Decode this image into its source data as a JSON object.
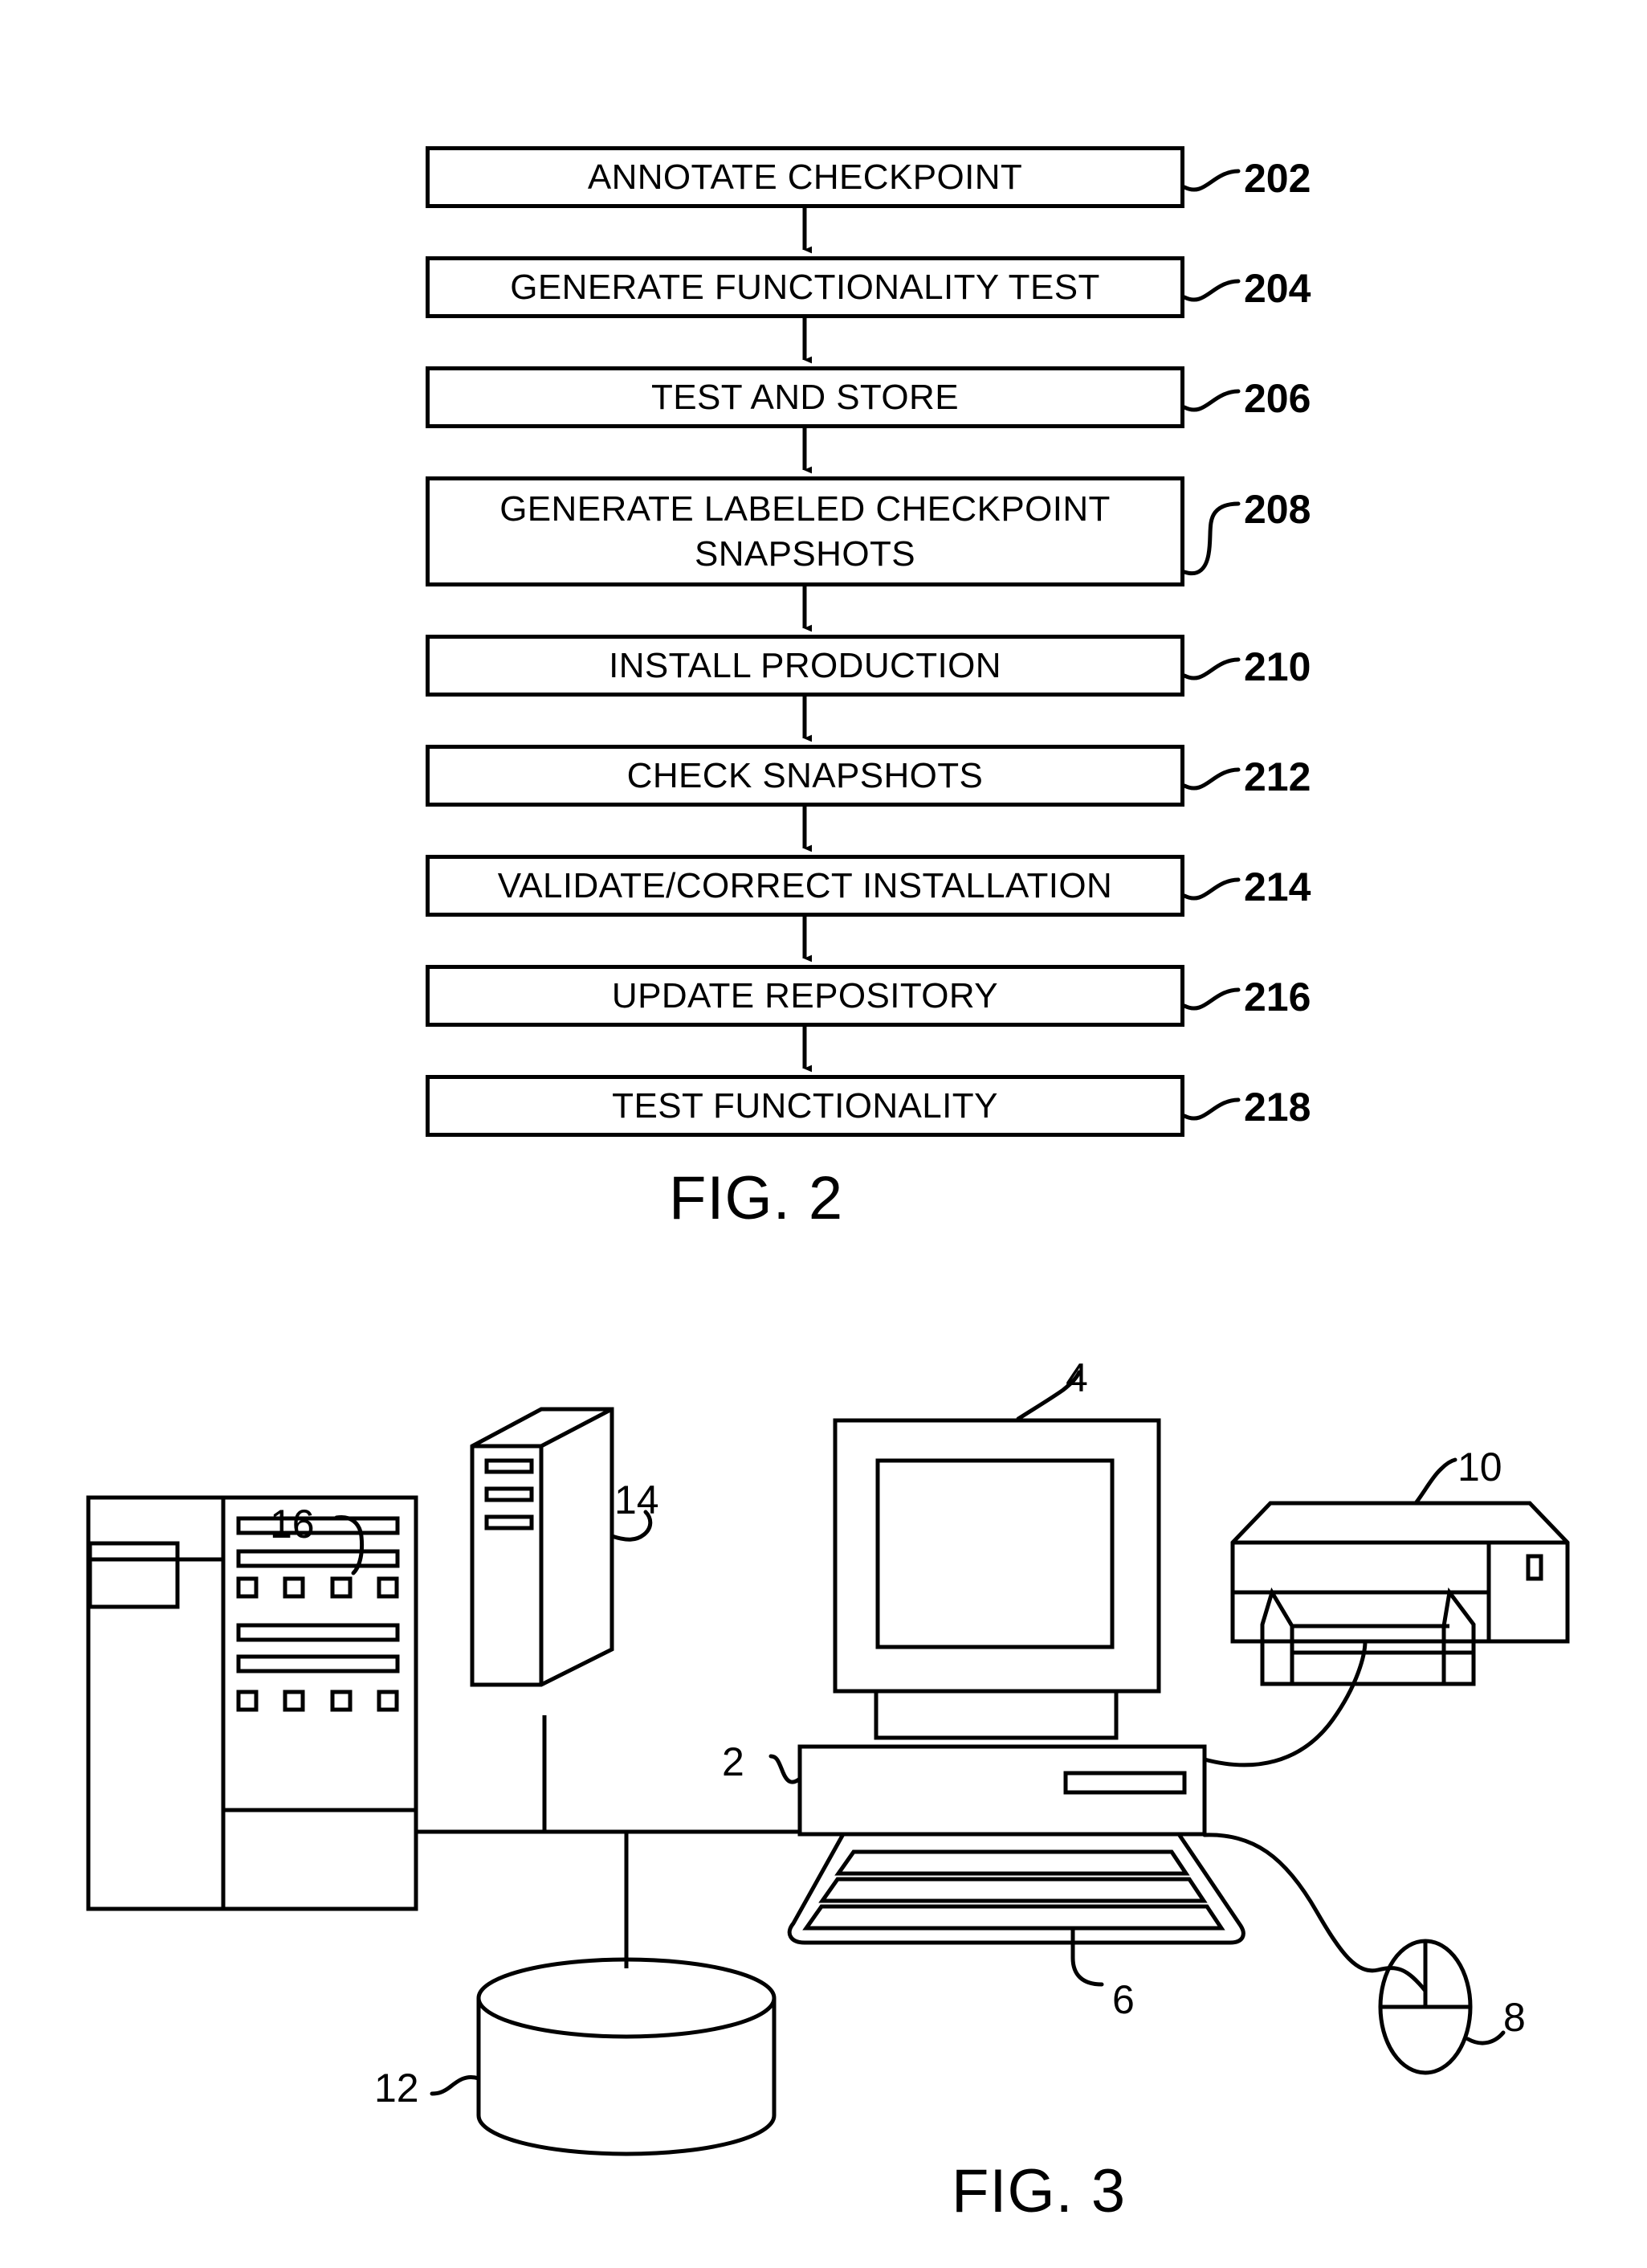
{
  "sheet": {
    "figures": [
      {
        "caption": "FIG. 2",
        "type": "flowchart",
        "steps": [
          {
            "label": "ANNOTATE CHECKPOINT",
            "ref": "202",
            "tall": false
          },
          {
            "label": "GENERATE FUNCTIONALITY TEST",
            "ref": "204",
            "tall": false
          },
          {
            "label": "TEST AND STORE",
            "ref": "206",
            "tall": false
          },
          {
            "label": "GENERATE LABELED CHECKPOINT SNAPSHOTS",
            "ref": "208",
            "tall": true
          },
          {
            "label": "INSTALL PRODUCTION",
            "ref": "210",
            "tall": false
          },
          {
            "label": "CHECK SNAPSHOTS",
            "ref": "212",
            "tall": false
          },
          {
            "label": "VALIDATE/CORRECT INSTALLATION",
            "ref": "214",
            "tall": false
          },
          {
            "label": "UPDATE REPOSITORY",
            "ref": "216",
            "tall": false
          },
          {
            "label": "TEST FUNCTIONALITY",
            "ref": "218",
            "tall": false
          }
        ]
      },
      {
        "caption": "FIG. 3",
        "type": "system-diagram",
        "components": [
          {
            "name": "mainframe",
            "ref": "16"
          },
          {
            "name": "tower-server",
            "ref": "14"
          },
          {
            "name": "monitor",
            "ref": "4"
          },
          {
            "name": "printer",
            "ref": "10"
          },
          {
            "name": "computer-base-unit",
            "ref": "2"
          },
          {
            "name": "keyboard",
            "ref": "6"
          },
          {
            "name": "mouse",
            "ref": "8"
          },
          {
            "name": "disk-storage",
            "ref": "12"
          }
        ]
      }
    ]
  },
  "colors": {
    "ink": "#000000",
    "paper": "#ffffff"
  }
}
